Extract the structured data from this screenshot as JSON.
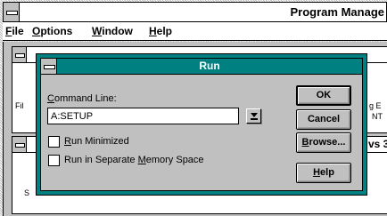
{
  "program_manager": {
    "title": "Program Manage",
    "menu": [
      {
        "label": "File",
        "key": "F"
      },
      {
        "label": "Options",
        "key": "O"
      },
      {
        "label": "Window",
        "key": "W"
      },
      {
        "label": "Help",
        "key": "H"
      }
    ]
  },
  "background_windows": {
    "left_text": "Fil",
    "right_text_1": "g E",
    "right_text_2": "NT",
    "lower_title": "vs 3",
    "lower_left_text": "S"
  },
  "run_dialog": {
    "title": "Run",
    "command_line_label": "Command Line:",
    "command_line_key": "C",
    "command_line_value": "A:SETUP",
    "run_minimized_label": "Run Minimized",
    "run_minimized_key": "R",
    "run_minimized_checked": false,
    "separate_memory_label": "Run in Separate Memory Space",
    "separate_memory_key": "M",
    "separate_memory_checked": false,
    "buttons": {
      "ok": "OK",
      "cancel": "Cancel",
      "browse": "Browse...",
      "help": "Help"
    }
  },
  "colors": {
    "dialog_frame": "#008080",
    "dialog_face": "#c0c0c0",
    "title_text": "#ffffff"
  },
  "icons": {
    "dropdown": "down-arrow-bar-icon",
    "system_menu": "system-menu-icon"
  }
}
